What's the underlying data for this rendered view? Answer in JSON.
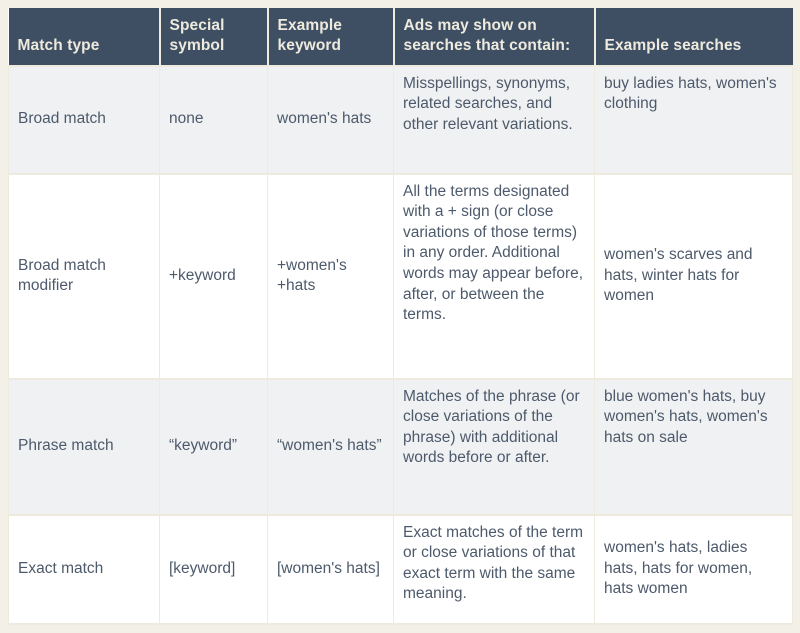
{
  "table": {
    "headers": [
      "Match type",
      "Special symbol",
      "Example keyword",
      "Ads may show on searches that contain:",
      "Example searches"
    ],
    "rows": [
      {
        "match_type": "Broad match",
        "special_symbol": "none",
        "example_keyword": "women's hats",
        "ads_may_show": "Misspellings, synonyms, related searches, and other relevant variations.",
        "example_searches": "buy ladies hats, women's clothing"
      },
      {
        "match_type": "Broad match modifier",
        "special_symbol": "+keyword",
        "example_keyword": "+women's +hats",
        "ads_may_show": "All the terms designated with a + sign (or close variations of those terms) in any order. Additional words may appear before, after, or between the terms.",
        "example_searches": "women's scarves and hats, winter hats for women"
      },
      {
        "match_type": "Phrase match",
        "special_symbol": "“keyword”",
        "example_keyword": "“women's hats”",
        "ads_may_show": "Matches of the phrase (or close variations of the phrase) with additional words before or after.",
        "example_searches": "blue women's hats, buy women's hats, women's hats on sale"
      },
      {
        "match_type": "Exact match",
        "special_symbol": "[keyword]",
        "example_keyword": "[women's hats]",
        "ads_may_show": "Exact matches of the term or close variations of that exact term with the same meaning.",
        "example_searches": "women's hats, ladies hats, hats for women, hats women"
      }
    ]
  },
  "colors": {
    "header_background": "#3e4f64",
    "header_text": "#eeeade",
    "body_text": "#4d5a6b",
    "row_shade": "#f0f1f3",
    "row_plain": "#ffffff",
    "border": "#eeeade",
    "page_background": "#f3f1e7"
  }
}
